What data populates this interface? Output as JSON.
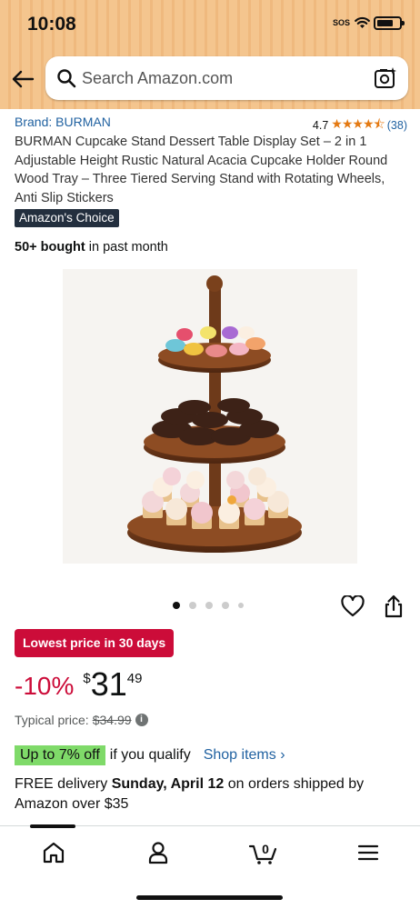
{
  "status_bar": {
    "time": "10:08",
    "sos": "SOS"
  },
  "header": {
    "search_placeholder": "Search Amazon.com"
  },
  "product": {
    "brand": "Brand: BURMAN",
    "rating": "4.7",
    "stars": "★★★★⯪",
    "review_count": "(38)",
    "title": "BURMAN Cupcake Stand Dessert Table Display Set – 2 in 1 Adjustable Height Rustic Natural Acacia Cupcake Holder Round Wood Tray – Three Tiered Serving Stand with Rotating Wheels, Anti Slip Stickers",
    "badge": "Amazon's Choice",
    "bought_bold": "50+ bought",
    "bought_rest": " in past month",
    "image_count": 5,
    "active_image": 1
  },
  "pricing": {
    "deal_badge": "Lowest price in 30 days",
    "discount": "-10%",
    "currency": "$",
    "price_whole": "31",
    "price_fraction": "49",
    "typical_label": "Typical price:",
    "typical_price": "$34.99",
    "promo_off": "Up to 7% off",
    "promo_text": "if you qualify",
    "promo_link": "Shop items ›",
    "delivery_pre": "FREE delivery ",
    "delivery_date": "Sunday, April 12",
    "delivery_post": " on orders shipped by Amazon over $35"
  },
  "bottom_nav": {
    "cart_count": "0"
  },
  "colors": {
    "header_bg": "#f4c58e",
    "deal_red": "#cc0c39",
    "link_blue": "#2162a1",
    "star_orange": "#e47911",
    "promo_green": "#7fda69",
    "badge_dark": "#232f3e"
  }
}
